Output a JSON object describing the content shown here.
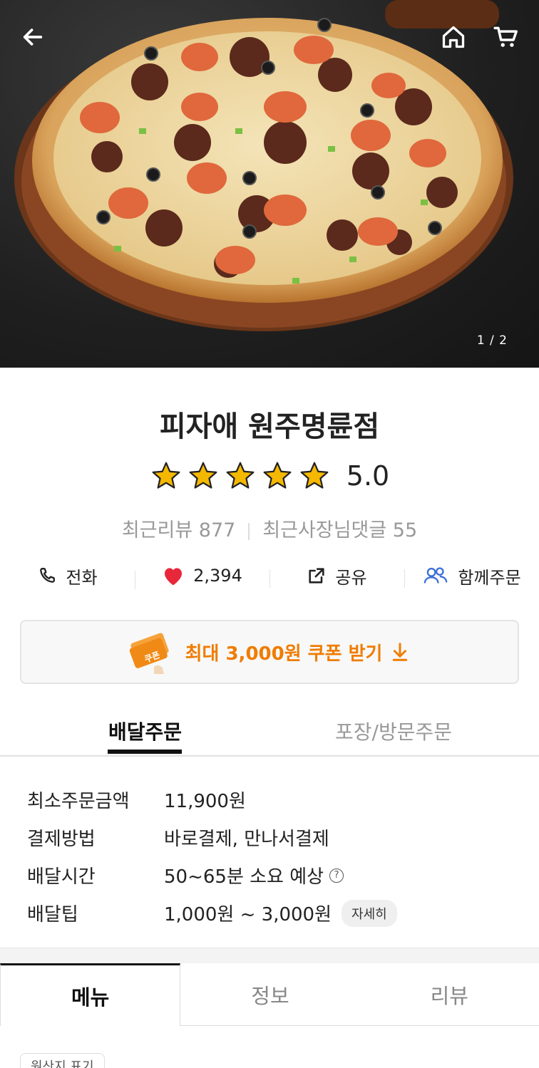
{
  "hero": {
    "image_counter": "1 / 2",
    "icons": {
      "back": "back-arrow-icon",
      "home": "home-icon",
      "cart": "cart-icon"
    }
  },
  "store": {
    "name": "피자애 원주명륜점",
    "rating": "5.0",
    "stars": 5,
    "recent_reviews": "최근리뷰 877",
    "owner_replies": "최근사장님댓글 55"
  },
  "actions": {
    "call": "전화",
    "likes": "2,394",
    "share": "공유",
    "group_order": "함께주문"
  },
  "coupon": {
    "badge": "쿠폰",
    "label": "최대 3,000원 쿠폰 받기"
  },
  "order_tabs": {
    "delivery": "배달주문",
    "pickup": "포장/방문주문"
  },
  "info": {
    "min_order_label": "최소주문금액",
    "min_order_value": "11,900원",
    "payment_label": "결제방법",
    "payment_value": "바로결제, 만나서결제",
    "time_label": "배달시간",
    "time_value": "50~65분 소요 예상",
    "tip_label": "배달팁",
    "tip_value": "1,000원 ~ 3,000원",
    "tip_detail_button": "자세히"
  },
  "section_tabs": {
    "menu": "메뉴",
    "info": "정보",
    "reviews": "리뷰"
  },
  "origin_chip": "원산지 표기",
  "colors": {
    "accent_orange": "#f07c00",
    "heart_red": "#e8273b",
    "star_gold": "#f5b800",
    "group_blue": "#3b6fd8"
  }
}
